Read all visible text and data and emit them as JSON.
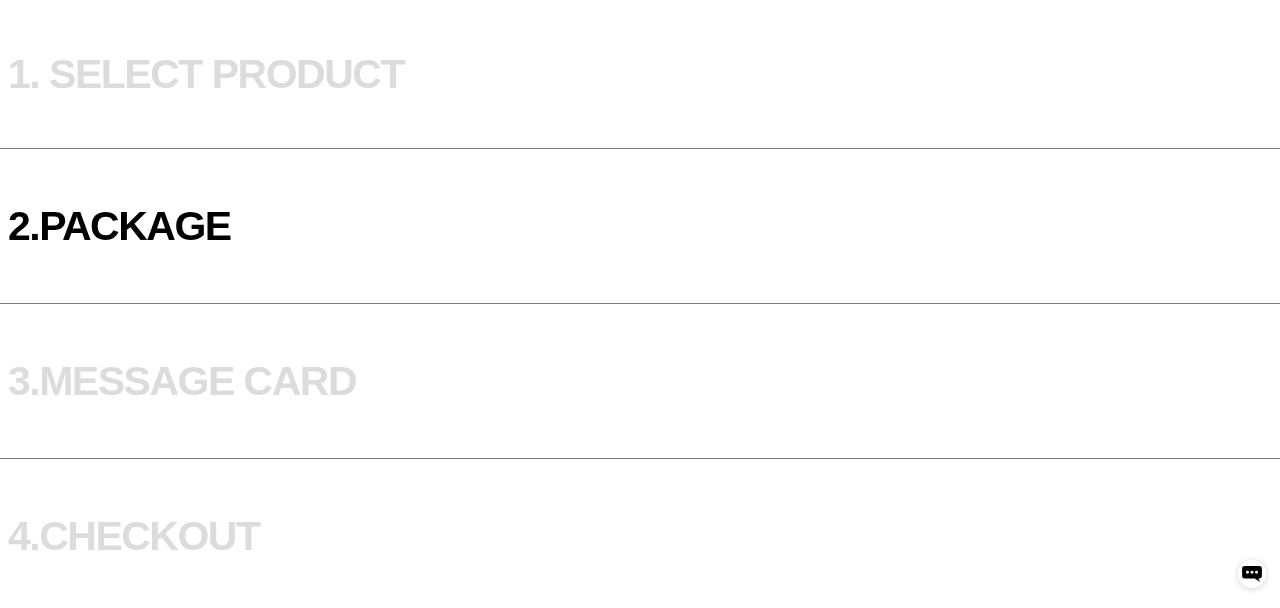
{
  "steps": [
    {
      "label": "1. SELECT PRODUCT",
      "selected": false
    },
    {
      "label": "2.PACKAGE",
      "selected": true
    },
    {
      "label": "3.MESSAGE CARD",
      "selected": false
    },
    {
      "label": "4.CHECKOUT",
      "selected": false
    }
  ]
}
